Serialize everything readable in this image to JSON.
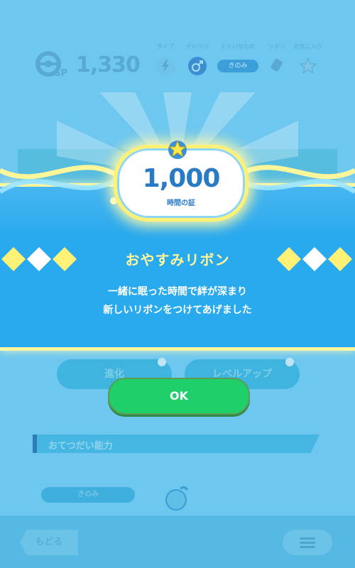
{
  "header": {
    "sp_label": "SP",
    "sp_value": "1,330",
    "stat_labels": [
      "タイプ",
      "せいべつ",
      "とくいなもの",
      "リボン",
      "お気に入り"
    ],
    "specialty_value": "きのみ"
  },
  "actions": {
    "evolve_label": "進化",
    "level_up_label": "レベルアップ"
  },
  "section": {
    "title": "おてつだい能力",
    "skill_pill": "きのみ"
  },
  "footer": {
    "back_label": "もどる"
  },
  "popup": {
    "value": "1,000",
    "value_label": "時間の証",
    "title": "おやすみリボン",
    "line1": "一緒に眠った時間で絆が深まり",
    "line2": "新しいリボンをつけてあげました",
    "ok_label": "OK"
  },
  "colors": {
    "background": "#6dc7ef",
    "band": "#29a9ee",
    "title_yellow": "#fff59a",
    "ok_green": "#1fcf6a"
  },
  "icons": [
    "pokeball-sp-icon",
    "electric-type-icon",
    "male-gender-icon",
    "ribbon-icon",
    "star-favorite-icon",
    "star-medal-icon",
    "menu-icon",
    "berry-skill-icon"
  ]
}
